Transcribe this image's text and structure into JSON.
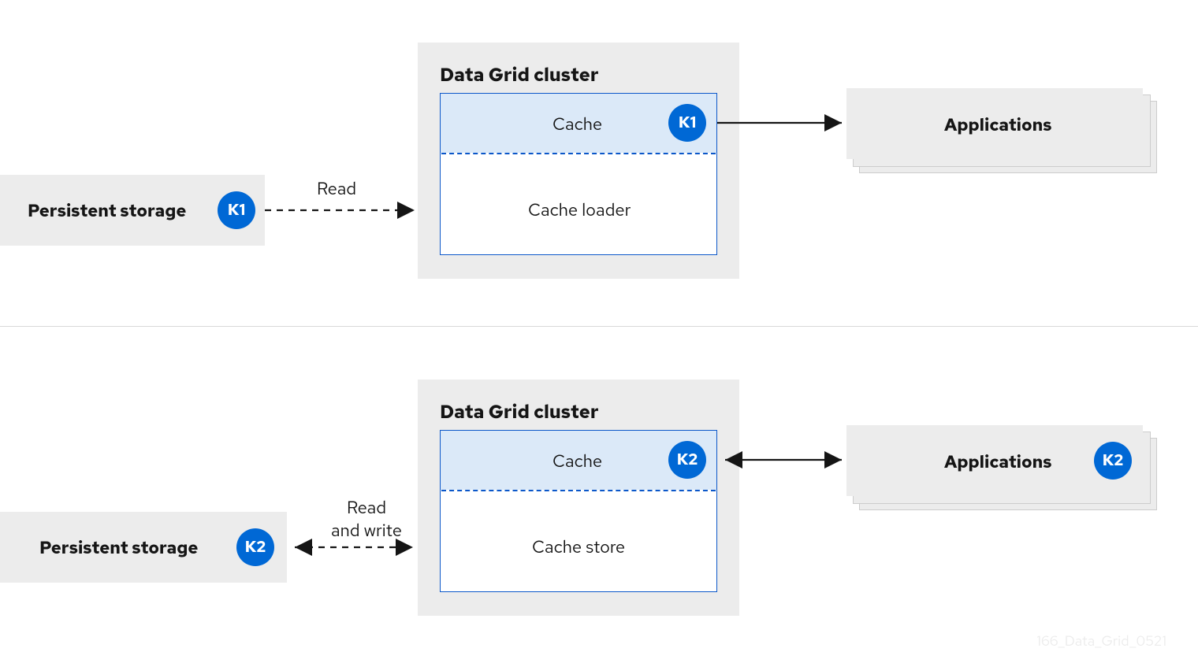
{
  "top": {
    "storage_label": "Persistent storage",
    "storage_key": "K1",
    "read_label": "Read",
    "cluster_title": "Data Grid cluster",
    "cache_label": "Cache",
    "cache_key": "K1",
    "loader_label": "Cache loader",
    "applications_label": "Applications"
  },
  "bottom": {
    "storage_label": "Persistent storage",
    "storage_key": "K2",
    "rw_label_line1": "Read",
    "rw_label_line2": "and write",
    "cluster_title": "Data Grid cluster",
    "cache_label": "Cache",
    "cache_key": "K2",
    "store_label": "Cache store",
    "applications_label": "Applications",
    "applications_key": "K2"
  },
  "watermark": "166_Data_Grid_0521"
}
